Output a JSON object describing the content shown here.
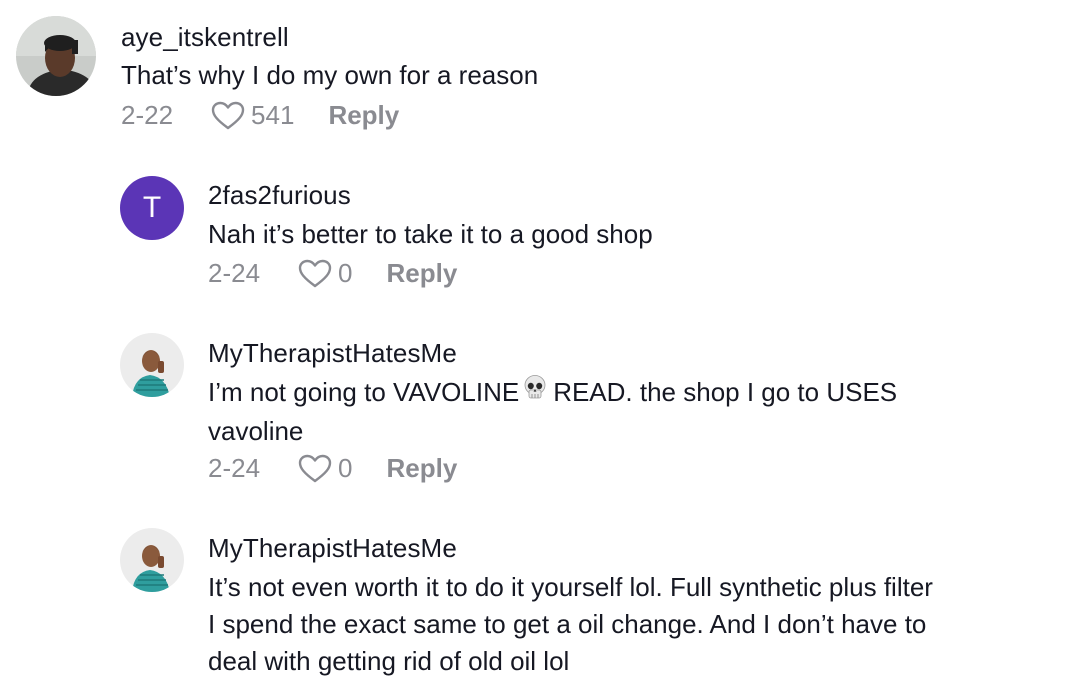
{
  "comments": [
    {
      "username": "aye_itskentrell",
      "avatar": "photo-avatar",
      "lines": [
        "That’s why I do my own for a reason"
      ],
      "date": "2-22",
      "likes": "541",
      "reply_label": "Reply"
    },
    {
      "username": "2fas2furious",
      "avatar_letter": "T",
      "avatar_color": "#5b35b6",
      "lines": [
        "Nah it’s better to take it to a good shop"
      ],
      "date": "2-24",
      "likes": "0",
      "reply_label": "Reply"
    },
    {
      "username": "MyTherapistHatesMe",
      "avatar": "photo-avatar",
      "lines": [
        "I’m not going to VAVOLINE",
        "READ. the shop I go to USES",
        "vavoline"
      ],
      "emoji": "skull-emoji",
      "date": "2-24",
      "likes": "0",
      "reply_label": "Reply"
    },
    {
      "username": "MyTherapistHatesMe",
      "avatar": "photo-avatar",
      "lines": [
        "It’s not even worth it to do it yourself lol. Full synthetic plus filter",
        "I spend the exact same to get a oil change. And I don’t have to",
        "deal with getting rid of old oil lol"
      ]
    }
  ],
  "colors": {
    "text": "#161823",
    "muted": "#8a8b91",
    "letter_avatar": "#5b35b6"
  },
  "icons": [
    "heart-icon",
    "skull-emoji"
  ]
}
